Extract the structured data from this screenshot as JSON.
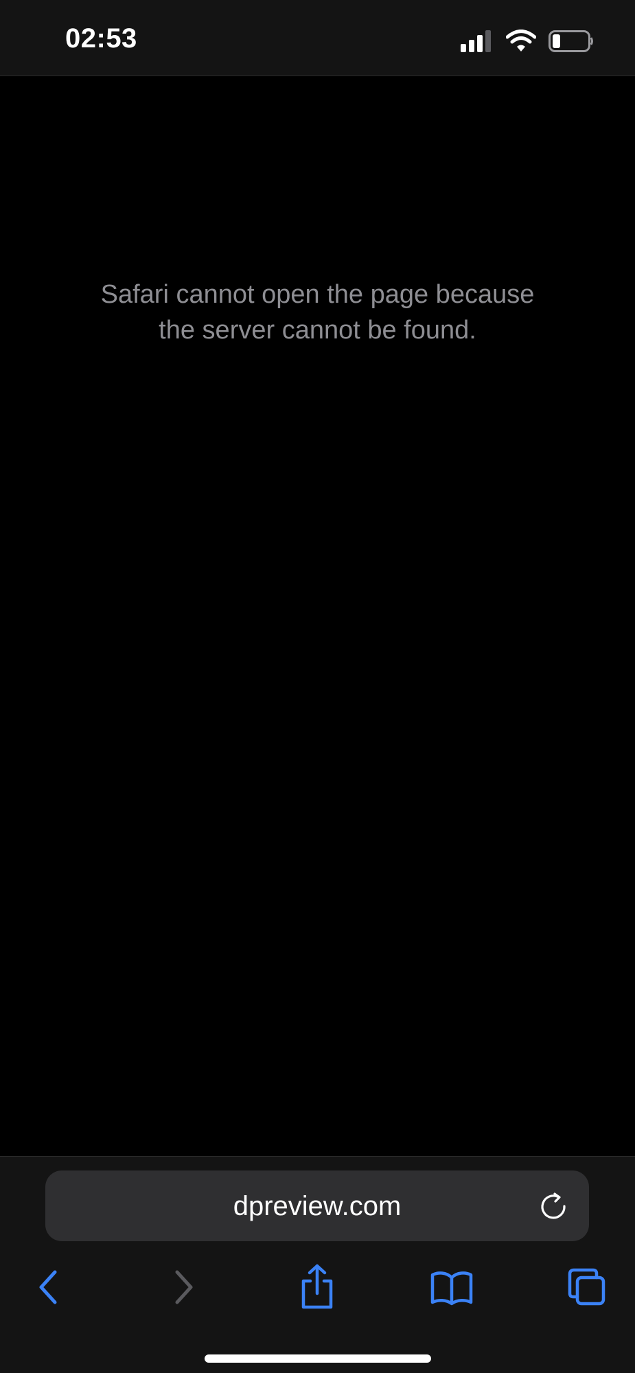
{
  "status_bar": {
    "time": "02:53",
    "icons": [
      "signal-icon",
      "wifi-icon",
      "battery-icon"
    ]
  },
  "page": {
    "error_line_1": "Safari cannot open the page because",
    "error_line_2": "the server cannot be found."
  },
  "address_bar": {
    "url": "dpreview.com",
    "icon": "reload-icon"
  },
  "toolbar": {
    "items": [
      "back-icon",
      "forward-icon",
      "share-icon",
      "bookmarks-icon",
      "tabs-icon"
    ]
  },
  "colors": {
    "accent": "#3b82f6",
    "disabled": "#5a5a5e",
    "message_text": "#8e8e93",
    "bar_background": "#141414",
    "field_background": "#2f2f31"
  }
}
